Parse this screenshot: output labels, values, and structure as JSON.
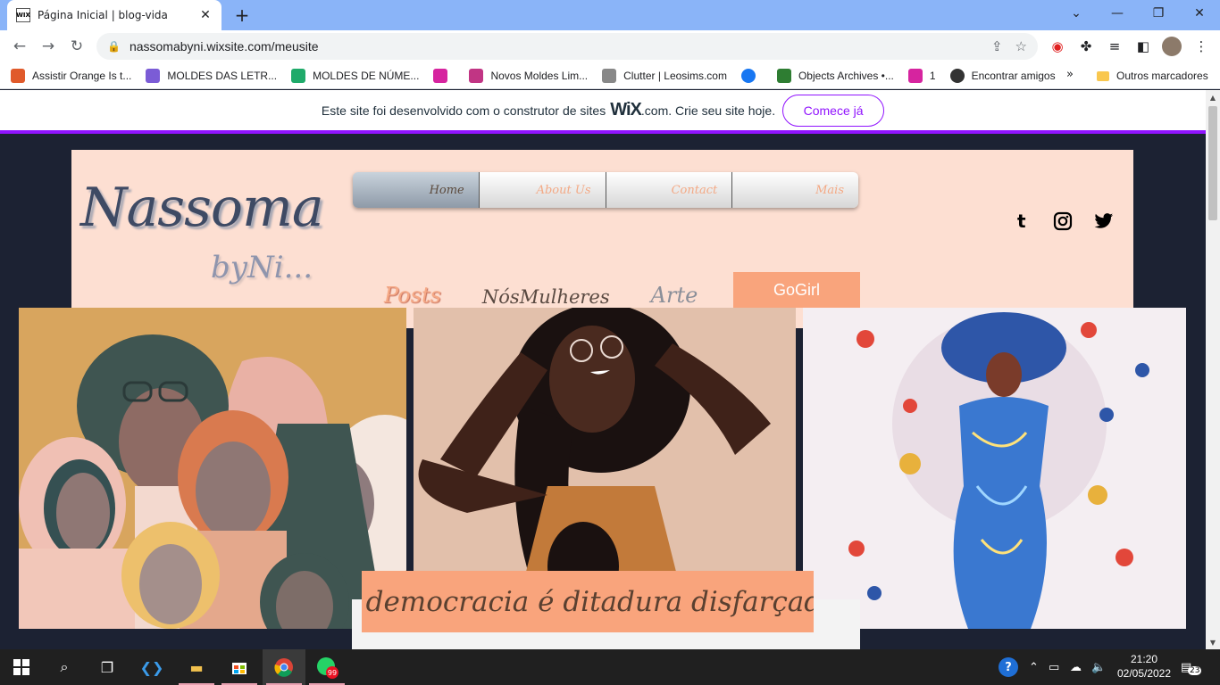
{
  "browser": {
    "tab_title": "Página Inicial | blog-vida",
    "favicon_text": "WIX",
    "url": "nassomabyni.wixsite.com/meusite",
    "bookmarks": [
      {
        "label": "Assistir Orange Is t...",
        "color": "#e05a2b"
      },
      {
        "label": "MOLDES DAS LETR...",
        "color": "#7b5cd6"
      },
      {
        "label": "MOLDES DE NÚME...",
        "color": "#1faa6a"
      },
      {
        "label": "",
        "color": "#d6249f"
      },
      {
        "label": "Novos Moldes Lim...",
        "color": "#c13584"
      },
      {
        "label": "Clutter | Leosims.com",
        "color": "#888888"
      },
      {
        "label": "",
        "color": "#1877f2"
      },
      {
        "label": "Objects Archives •...",
        "color": "#2e7d32"
      },
      {
        "label": "1",
        "color": "#d6249f"
      },
      {
        "label": "Encontrar amigos",
        "color": "#333333"
      }
    ],
    "more_bookmarks": "»",
    "other_bookmarks": "Outros marcadores"
  },
  "wix_banner": {
    "message_before": "Este site foi desenvolvido com o construtor de sites",
    "logo": "WiX",
    "message_after": ".com. Crie seu site hoje.",
    "cta": "Comece já"
  },
  "site": {
    "logo_main": "Nassoma",
    "logo_sub": "byNi...",
    "menu": [
      "Home",
      "About Us",
      "Contact",
      "Mais"
    ],
    "categories": [
      "Posts",
      "NósMulheres",
      "Arte"
    ],
    "highlight_category": "GoGirl",
    "quote": "A democracia é ditadura disfarçada",
    "colors": {
      "header_bg": "#fddfd2",
      "accent": "#f9a47c",
      "page_bg": "#1c2233"
    }
  },
  "taskbar": {
    "whatsapp_badge": "99",
    "time": "21:20",
    "date": "02/05/2022",
    "notifications": "23"
  }
}
